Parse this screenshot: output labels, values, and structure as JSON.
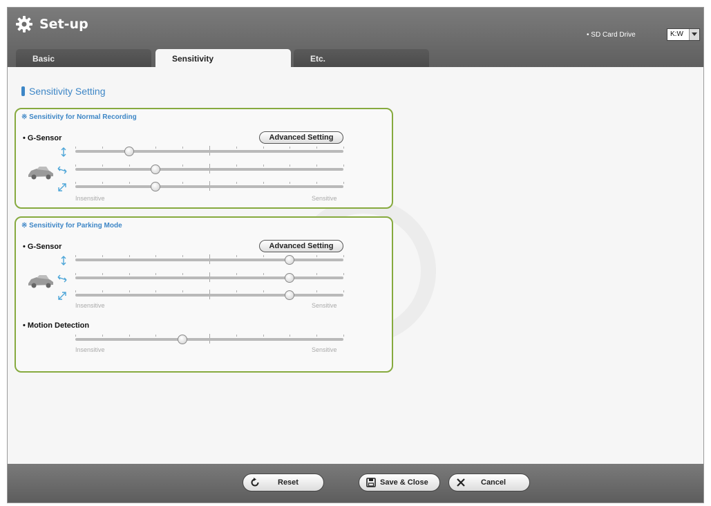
{
  "window": {
    "title": "Set-up",
    "sd_card": {
      "label": "• SD Card Drive",
      "selected": "K:W"
    }
  },
  "tabs": [
    {
      "label": "Basic",
      "active": false
    },
    {
      "label": "Sensitivity",
      "active": true
    },
    {
      "label": "Etc.",
      "active": false
    }
  ],
  "section_heading": "Sensitivity Setting",
  "normal_panel": {
    "title": "※ Sensitivity for Normal Recording",
    "gsensor_label": "• G-Sensor",
    "advanced_label": "Advanced Setting",
    "sliders": [
      {
        "axis": "vertical-axis",
        "value": 0.2
      },
      {
        "axis": "lateral-axis",
        "value": 0.3
      },
      {
        "axis": "diagonal-axis",
        "value": 0.3
      }
    ],
    "min_label": "Insensitive",
    "max_label": "Sensitive"
  },
  "parking_panel": {
    "title": "※ Sensitivity for Parking Mode",
    "gsensor_label": "• G-Sensor",
    "advanced_label": "Advanced Setting",
    "sliders": [
      {
        "axis": "vertical-axis",
        "value": 0.8
      },
      {
        "axis": "lateral-axis",
        "value": 0.8
      },
      {
        "axis": "diagonal-axis",
        "value": 0.8
      }
    ],
    "min_label": "Insensitive",
    "max_label": "Sensitive",
    "motion_label": "• Motion Detection",
    "motion_value": 0.4,
    "motion_min_label": "Insensitive",
    "motion_max_label": "Sensitive"
  },
  "footer": {
    "reset_label": "Reset",
    "save_label": "Save & Close",
    "cancel_label": "Cancel"
  },
  "colors": {
    "accent": "#3d86c6",
    "panel_border": "#86aa3e",
    "chrome": "#666666"
  },
  "icons": [
    "gear-icon",
    "car-icon",
    "vertical-axis-icon",
    "lateral-axis-icon",
    "diagonal-axis-icon",
    "reset-icon",
    "save-icon",
    "close-icon"
  ]
}
